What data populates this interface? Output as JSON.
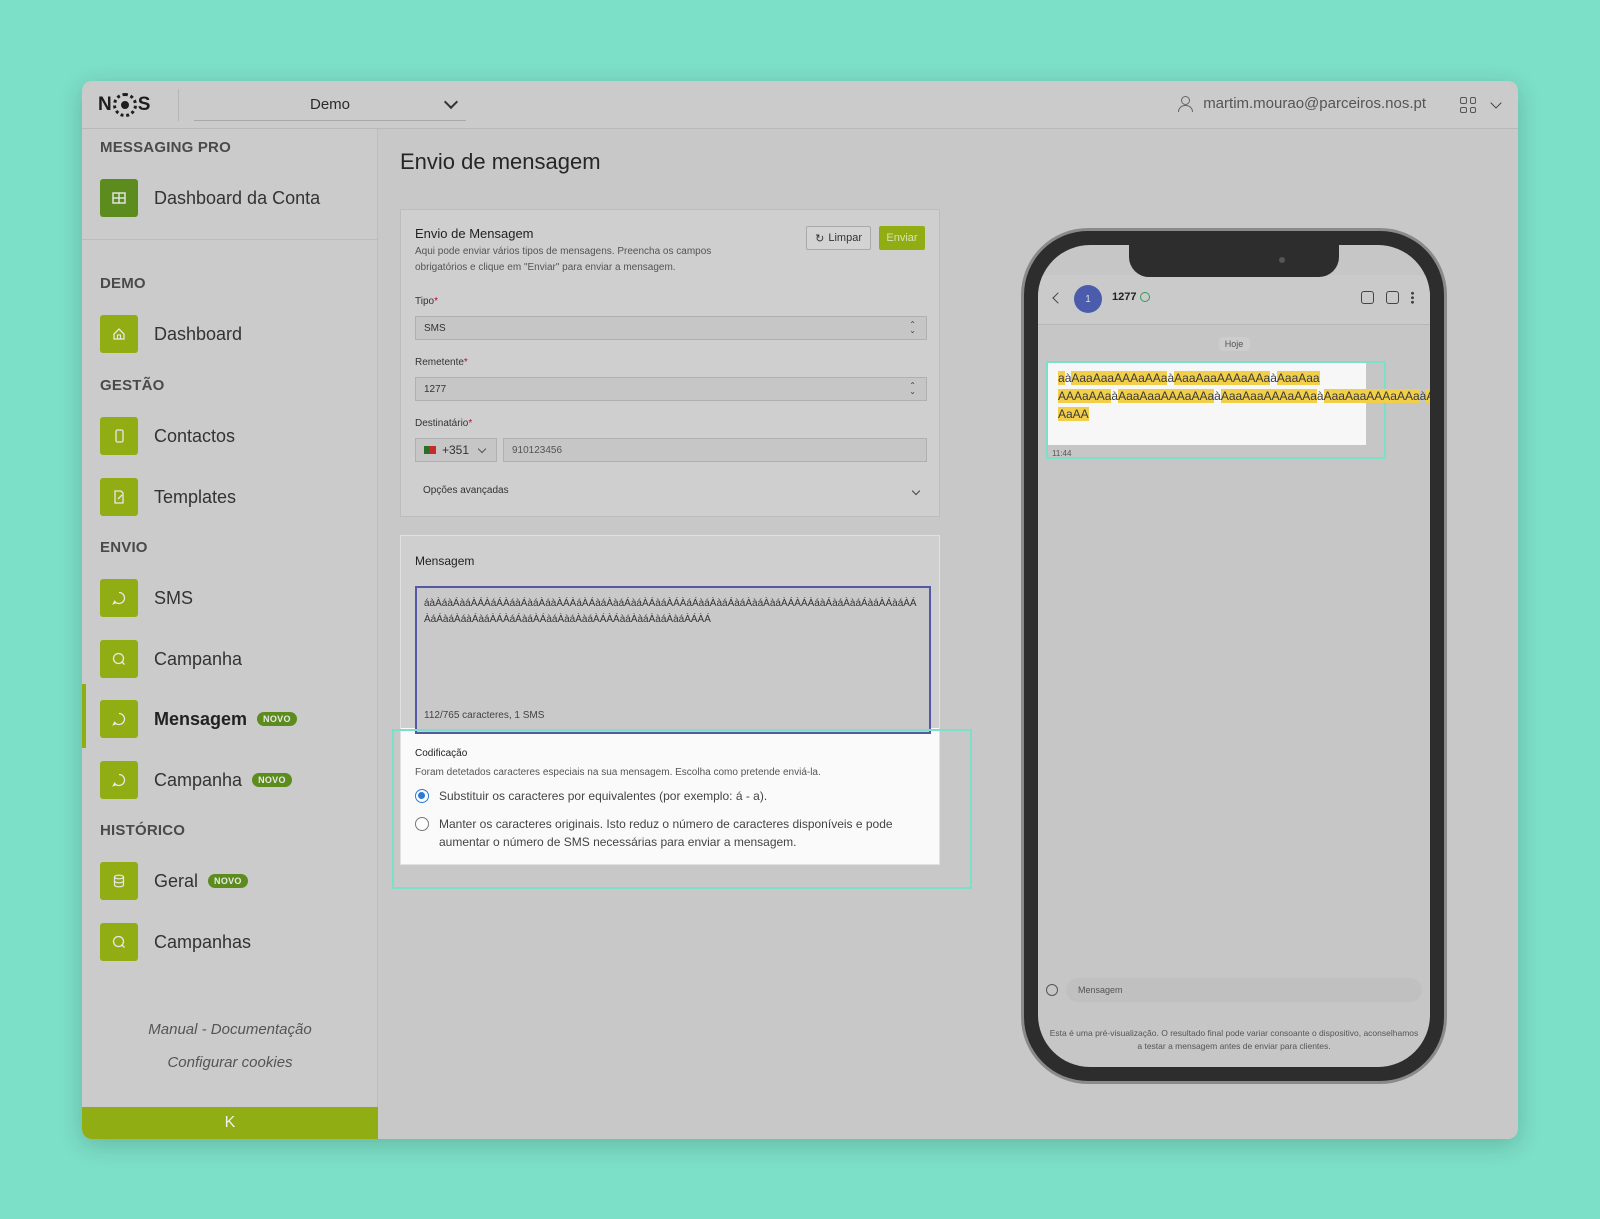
{
  "topbar": {
    "logo_text_left": "N",
    "logo_text_right": "S",
    "account": "Demo",
    "user_email": "martim.mourao@parceiros.nos.pt"
  },
  "sidebar": {
    "brand_section": "MESSAGING PRO",
    "dashboard_conta": "Dashboard da Conta",
    "demo_section": "DEMO",
    "dashboard": "Dashboard",
    "gestao_section": "GESTÃO",
    "contactos": "Contactos",
    "templates": "Templates",
    "envio_section": "ENVIO",
    "sms": "SMS",
    "campanha": "Campanha",
    "mensagem": "Mensagem",
    "campanha2": "Campanha",
    "historico_section": "HISTÓRICO",
    "geral": "Geral",
    "campanhas": "Campanhas",
    "badge_novo": "NOVO",
    "manual": "Manual - Documentação",
    "cookies": "Configurar cookies",
    "collapse_icon": "K"
  },
  "page": {
    "title": "Envio de mensagem"
  },
  "form": {
    "title": "Envio de Mensagem",
    "description": "Aqui pode enviar vários tipos de mensagens. Preencha os campos obrigatórios e clique em \"Enviar\" para enviar a mensagem.",
    "limpar": "Limpar",
    "enviar": "Enviar",
    "tipo_label": "Tipo",
    "tipo_value": "SMS",
    "remetente_label": "Remetente",
    "remetente_value": "1277",
    "destinatario_label": "Destinatário",
    "prefix": "+351",
    "phone_placeholder": "910123456",
    "advanced": "Opções avançadas",
    "required_mark": "*"
  },
  "message": {
    "label": "Mensagem",
    "text": "áàÀáàÁàáÀÁÀáÁÀáàÁàáÀáàÀÁÀáÀÁàáÀàáÁàáÀÁàáÀÁÀáÁàáÀàáÁàáÀàáÀàáÀÁÀÁÀáàÁàáÀàáÁàáÀÁàáÀÁÀáÁàáÀáàÁàáÀÁÀáÁàáÀÁàáÀàáÀàáÀÁÀÁàáÀàáÀàáÀàáÀÁÀÁ",
    "count": "112/765 caracteres, 1 SMS",
    "codificacao_title": "Codificação",
    "codificacao_desc": "Foram detetados caracteres especiais na sua mensagem. Escolha como pretende enviá-la.",
    "option_substituir": "Substituir os caracteres por equivalentes (por exemplo: á - a).",
    "option_manter": "Manter os caracteres originais. Isto reduz o número de caracteres disponíveis e pode aumentar o número de SMS necessárias para enviar a mensagem.",
    "selected_option": "substituir"
  },
  "phone": {
    "avatar": "1",
    "sender": "1277",
    "today": "Hoje",
    "time": "11:44",
    "composer_placeholder": "Mensagem",
    "note": "Esta é uma pré-visualização. O resultado final pode variar consoante o dispositivo, aconselhamos a testar a mensagem antes de enviar para clientes.",
    "bubble_segments": [
      {
        "t": "a",
        "h": true
      },
      {
        "t": "à",
        "h": false
      },
      {
        "t": "AaaAaaAAAaAAa",
        "h": true
      },
      {
        "t": "à",
        "h": false
      },
      {
        "t": "AaaAaaAAAaAAa",
        "h": true
      },
      {
        "t": "à",
        "h": false
      },
      {
        "t": "AaaAaa AAAaAAa",
        "h": true
      },
      {
        "t": "à",
        "h": false
      },
      {
        "t": "AaaAaaAAAaAAa",
        "h": true
      },
      {
        "t": "à",
        "h": false
      },
      {
        "t": "AaaAaaAAAaAAa",
        "h": true
      },
      {
        "t": "à",
        "h": false
      },
      {
        "t": "AaaAaaAAAaAAa",
        "h": true
      },
      {
        "t": "à",
        "h": false
      },
      {
        "t": "AaaAaaAAAaAAa",
        "h": true
      },
      {
        "t": "à",
        "h": false
      },
      {
        "t": "AaaAaaAA AaAA",
        "h": true
      }
    ]
  },
  "colors": {
    "brand_green": "#90ad14",
    "badge_green": "#5c8b1e",
    "highlight": "#7cdfc7",
    "radio_blue": "#2b79d9"
  }
}
